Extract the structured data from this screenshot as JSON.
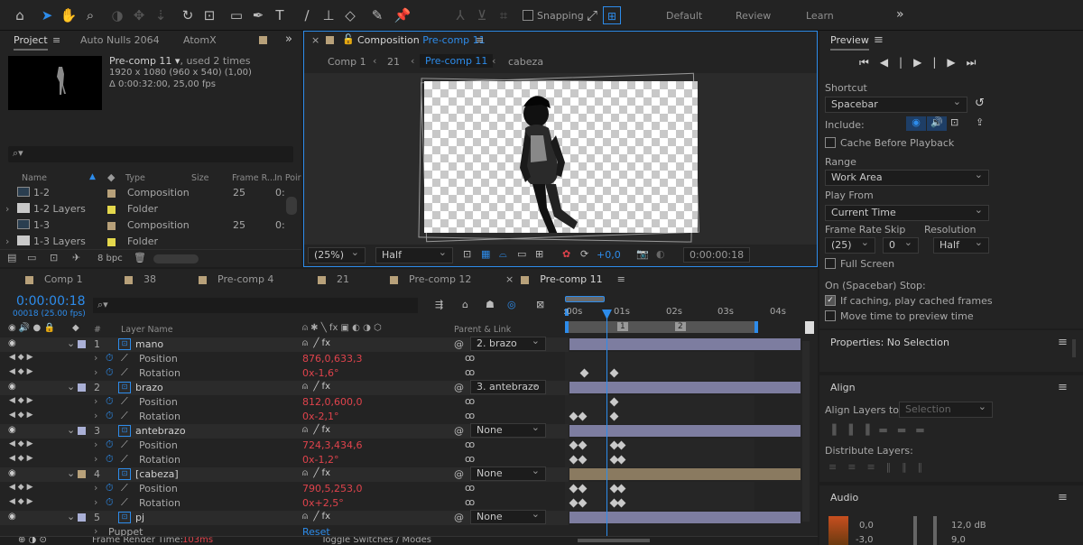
{
  "toolbar": {
    "snapping": "Snapping",
    "workspaces": [
      "Default",
      "Review",
      "Learn"
    ],
    "more": "»"
  },
  "project": {
    "tabs": [
      "Project",
      "Auto Nulls 2064",
      "AtomX"
    ],
    "item_name": "Pre-comp 11 ▾",
    "used": ", used 2 times",
    "res": "1920 x 1080  (960 x 540) (1,00)",
    "dur": "Δ 0:00:32:00, 25,00 fps",
    "search_placeholder": "",
    "cols": [
      "Name",
      "Type",
      "Size",
      "Frame R...",
      "In Poir"
    ],
    "rows": [
      {
        "name": "1-2",
        "type": "Composition",
        "size": "",
        "fr": "25",
        "inp": "0:",
        "color": "#b8a17a",
        "kind": "comp"
      },
      {
        "name": "1-2 Layers",
        "type": "Folder",
        "size": "",
        "fr": "",
        "inp": "",
        "color": "#e4d84c",
        "kind": "folder"
      },
      {
        "name": "1-3",
        "type": "Composition",
        "size": "",
        "fr": "25",
        "inp": "0:",
        "color": "#b8a17a",
        "kind": "comp"
      },
      {
        "name": "1-3 Layers",
        "type": "Folder",
        "size": "",
        "fr": "",
        "inp": "",
        "color": "#e4d84c",
        "kind": "folder"
      }
    ],
    "bpc": "8 bpc"
  },
  "comp_viewer": {
    "tab_label": "Composition",
    "tab_name": "Pre-comp 11",
    "breadcrumbs": [
      "Comp 1",
      "21",
      "Pre-comp 11",
      "cabeza"
    ],
    "zoom": "(25%)",
    "resolution": "Half",
    "exposure": "+0,0",
    "timecode": "0:00:00:18"
  },
  "preview": {
    "title": "Preview",
    "shortcut_label": "Shortcut",
    "shortcut": "Spacebar",
    "include_label": "Include:",
    "cache_label": "Cache Before Playback",
    "range_label": "Range",
    "range": "Work Area",
    "playfrom_label": "Play From",
    "playfrom": "Current Time",
    "fr_label": "Frame Rate",
    "skip_label": "Skip",
    "res_label": "Resolution",
    "fr": "(25)",
    "skip": "0",
    "res": "Half",
    "fullscreen": "Full Screen",
    "stop_label": "On (Spacebar) Stop:",
    "stop1": "If caching, play cached frames",
    "stop2": "Move time to preview time"
  },
  "properties": {
    "title": "Properties: No Selection"
  },
  "align": {
    "title": "Align",
    "align_to": "Align Layers to:",
    "selection": "Selection",
    "distribute": "Distribute Layers:"
  },
  "audio": {
    "title": "Audio",
    "db": [
      "0,0",
      "-3,0"
    ],
    "db2": [
      "12,0 dB",
      "9,0"
    ]
  },
  "timeline": {
    "tabs": [
      {
        "name": "Comp 1",
        "color": "#b8a17a"
      },
      {
        "name": "38",
        "color": "#b8a17a"
      },
      {
        "name": "Pre-comp 4",
        "color": "#b8a17a"
      },
      {
        "name": "21",
        "color": "#b8a17a"
      },
      {
        "name": "Pre-comp 12",
        "color": "#b8a17a"
      },
      {
        "name": "Pre-comp 11",
        "color": "#b8a17a"
      }
    ],
    "timecode": "0:00:00:18",
    "frame_info": "00018 (25.00 fps)",
    "col_layer": "Layer Name",
    "col_parent": "Parent & Link",
    "ruler": [
      ":00s",
      "01s",
      "02s",
      "03s",
      "04s"
    ],
    "markers": [
      "1",
      "2"
    ],
    "layers": [
      {
        "num": "1",
        "name": "mano",
        "parent": "2. brazo",
        "color": "#aab0d6",
        "pos": "876,0,633,3",
        "rot": "0x-1,6°"
      },
      {
        "num": "2",
        "name": "brazo",
        "parent": "3. antebrazo",
        "color": "#aab0d6",
        "pos": "812,0,600,0",
        "rot": "0x-2,1°"
      },
      {
        "num": "3",
        "name": "antebrazo",
        "parent": "None",
        "color": "#aab0d6",
        "pos": "724,3,434,6",
        "rot": "0x-1,2°"
      },
      {
        "num": "4",
        "name": "[cabeza]",
        "parent": "None",
        "color": "#b8a17a",
        "pos": "790,5,253,0",
        "rot": "0x+2,5°"
      },
      {
        "num": "5",
        "name": "pj",
        "parent": "None",
        "color": "#aab0d6"
      }
    ],
    "prop_position": "Position",
    "prop_rotation": "Rotation",
    "puppet": "Puppet",
    "reset": "Reset",
    "render_time_label": "Frame Render Time:",
    "render_time": "103ms",
    "toggle": "Toggle Switches / Modes"
  }
}
